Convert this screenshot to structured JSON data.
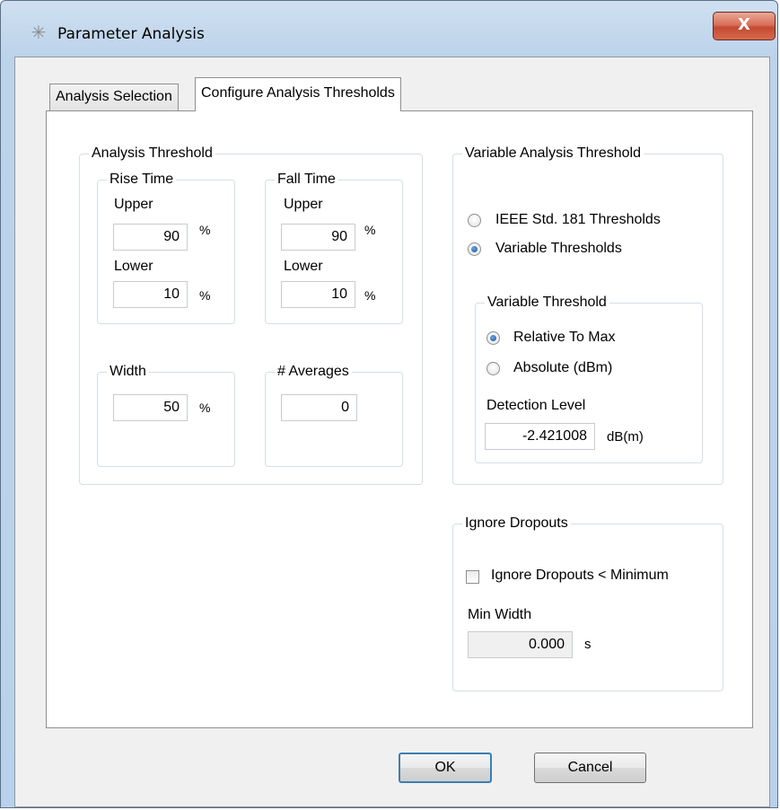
{
  "window": {
    "title": "Parameter Analysis",
    "close_label": "X"
  },
  "tabs": [
    {
      "label": "Analysis Selection"
    },
    {
      "label": "Configure Analysis Thresholds"
    }
  ],
  "analysis_threshold": {
    "legend": "Analysis Threshold",
    "rise_time": {
      "legend": "Rise Time",
      "upper_label": "Upper",
      "upper_value": "90",
      "upper_unit": "%",
      "lower_label": "Lower",
      "lower_value": "10",
      "lower_unit": "%"
    },
    "fall_time": {
      "legend": "Fall Time",
      "upper_label": "Upper",
      "upper_value": "90",
      "upper_unit": "%",
      "lower_label": "Lower",
      "lower_value": "10",
      "lower_unit": "%"
    },
    "width": {
      "legend": "Width",
      "value": "50",
      "unit": "%"
    },
    "averages": {
      "legend": "# Averages",
      "value": "0"
    }
  },
  "variable_analysis_threshold": {
    "legend": "Variable Analysis Threshold",
    "options": [
      {
        "label": "IEEE Std. 181 Thresholds",
        "checked": false
      },
      {
        "label": "Variable Thresholds",
        "checked": true
      }
    ],
    "variable_threshold": {
      "legend": "Variable Threshold",
      "options": [
        {
          "label": "Relative To Max",
          "checked": true
        },
        {
          "label": "Absolute (dBm)",
          "checked": false
        }
      ],
      "detection_label": "Detection Level",
      "detection_value": "-2.421008",
      "detection_unit": "dB(m)"
    }
  },
  "ignore_dropouts": {
    "legend": "Ignore Dropouts",
    "checkbox_label": "Ignore Dropouts < Minimum",
    "checked": false,
    "min_width_label": "Min Width",
    "min_width_value": "0.000",
    "min_width_unit": "s"
  },
  "buttons": {
    "ok": "OK",
    "cancel": "Cancel"
  },
  "colors": {
    "title_gradient": "#bdd3ea",
    "close_button": "#c34a33",
    "radio_dot": "#1f5da8"
  }
}
